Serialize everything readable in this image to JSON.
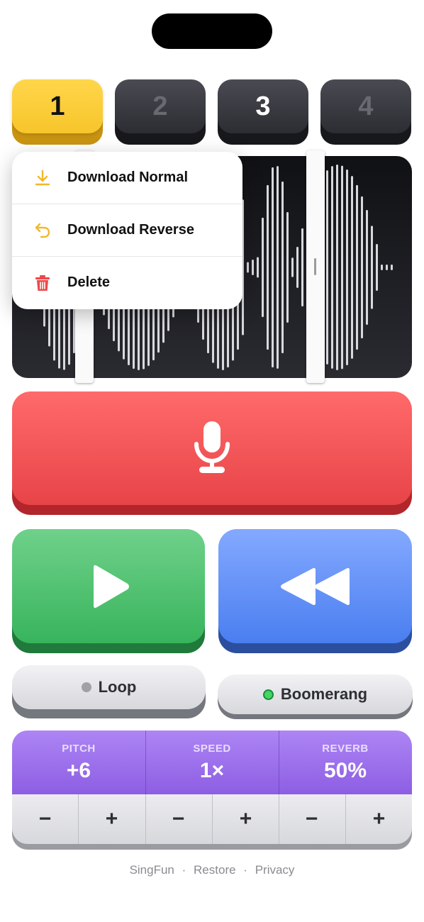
{
  "slots": [
    "1",
    "2",
    "3",
    "4"
  ],
  "menu": {
    "download_normal": "Download Normal",
    "download_reverse": "Download Reverse",
    "delete": "Delete"
  },
  "toggles": {
    "loop": "Loop",
    "boomerang": "Boomerang"
  },
  "effects": {
    "pitch_label": "PITCH",
    "pitch_value": "+6",
    "speed_label": "SPEED",
    "speed_value": "1×",
    "reverb_label": "REVERB",
    "reverb_value": "50%",
    "minus": "−",
    "plus": "+"
  },
  "footer": {
    "app": "SingFun",
    "restore": "Restore",
    "privacy": "Privacy",
    "separator": "·"
  },
  "colors": {
    "record": "#e84448",
    "play": "#38b45c",
    "reverse": "#4a7ef0",
    "selected_slot": "#f7c52b",
    "effects": "#8d5ee3"
  },
  "icons": [
    "download-icon",
    "undo-arrow-icon",
    "trash-icon",
    "microphone-icon",
    "play-icon",
    "rewind-icon"
  ]
}
